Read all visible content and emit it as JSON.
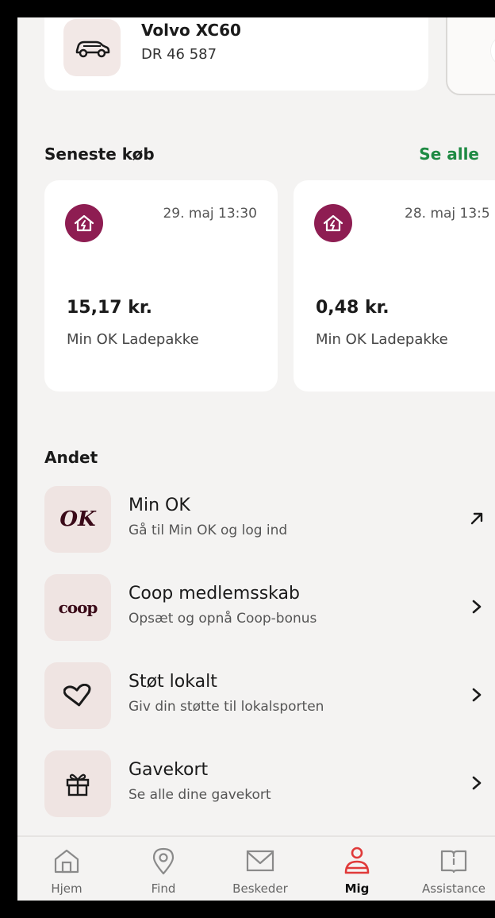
{
  "vehicle": {
    "name": "Volvo XC60",
    "plate": "DR 46 587"
  },
  "recent": {
    "title": "Seneste køb",
    "see_all": "Se alle",
    "items": [
      {
        "date": "29. maj 13:30",
        "amount": "15,17 kr.",
        "desc": "Min OK Ladepakke"
      },
      {
        "date": "28. maj 13:5",
        "amount": "0,48 kr.",
        "desc": "Min OK Ladepakke"
      }
    ]
  },
  "other": {
    "title": "Andet",
    "items": [
      {
        "title": "Min OK",
        "sub": "Gå til Min OK og log ind",
        "icon": "ok-logo",
        "action": "external-arrow-icon"
      },
      {
        "title": "Coop medlemsskab",
        "sub": "Opsæt og opnå Coop-bonus",
        "icon": "coop-logo",
        "action": "chevron-right-icon"
      },
      {
        "title": "Støt lokalt",
        "sub": "Giv din støtte til lokalsporten",
        "icon": "heart-icon",
        "action": "chevron-right-icon"
      },
      {
        "title": "Gavekort",
        "sub": "Se alle dine gavekort",
        "icon": "gift-icon",
        "action": "chevron-right-icon"
      }
    ],
    "ok_logo_text": "OK",
    "coop_logo_text": "coop"
  },
  "tabs": [
    {
      "label": "Hjem",
      "icon": "home-icon"
    },
    {
      "label": "Find",
      "icon": "location-pin-icon"
    },
    {
      "label": "Beskeder",
      "icon": "mail-icon"
    },
    {
      "label": "Mig",
      "icon": "user-icon",
      "active": true
    },
    {
      "label": "Assistance",
      "icon": "book-icon"
    }
  ],
  "colors": {
    "accent": "#8e1d52",
    "link": "#1e8a43",
    "active_tab": "#e03a3a"
  }
}
